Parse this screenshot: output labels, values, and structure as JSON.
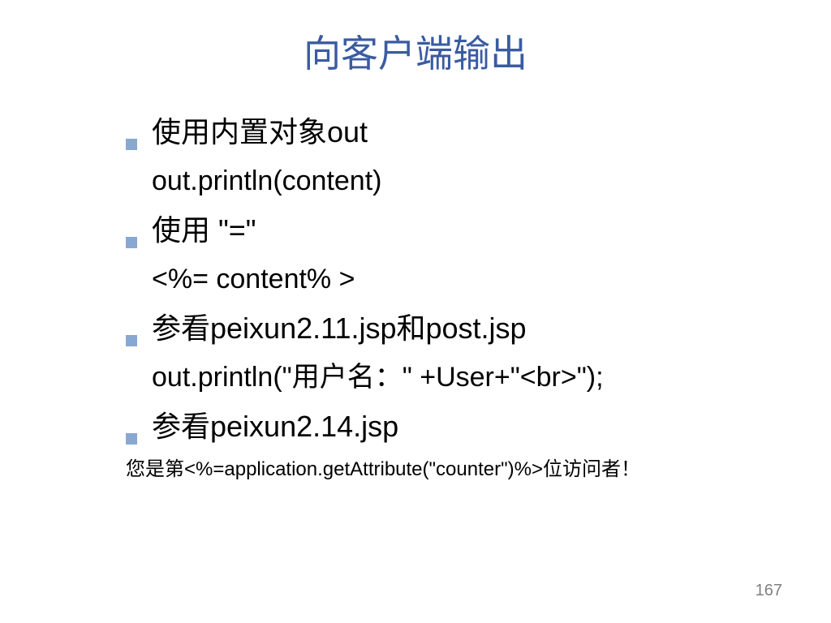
{
  "slide": {
    "title": "向客户端输出",
    "items": [
      {
        "bullet": "使用内置对象out",
        "sub": "out.println(content)"
      },
      {
        "bullet": "使用 \"=\"",
        "sub": "<%= content% >"
      },
      {
        "bullet": "参看peixun2.11.jsp和post.jsp",
        "sub": "out.println(\"用户名：\" +User+\"<br>\");"
      },
      {
        "bullet": "参看peixun2.14.jsp",
        "small": "您是第<%=application.getAttribute(\"counter\")%>位访问者！"
      }
    ],
    "pageNumber": "167"
  }
}
